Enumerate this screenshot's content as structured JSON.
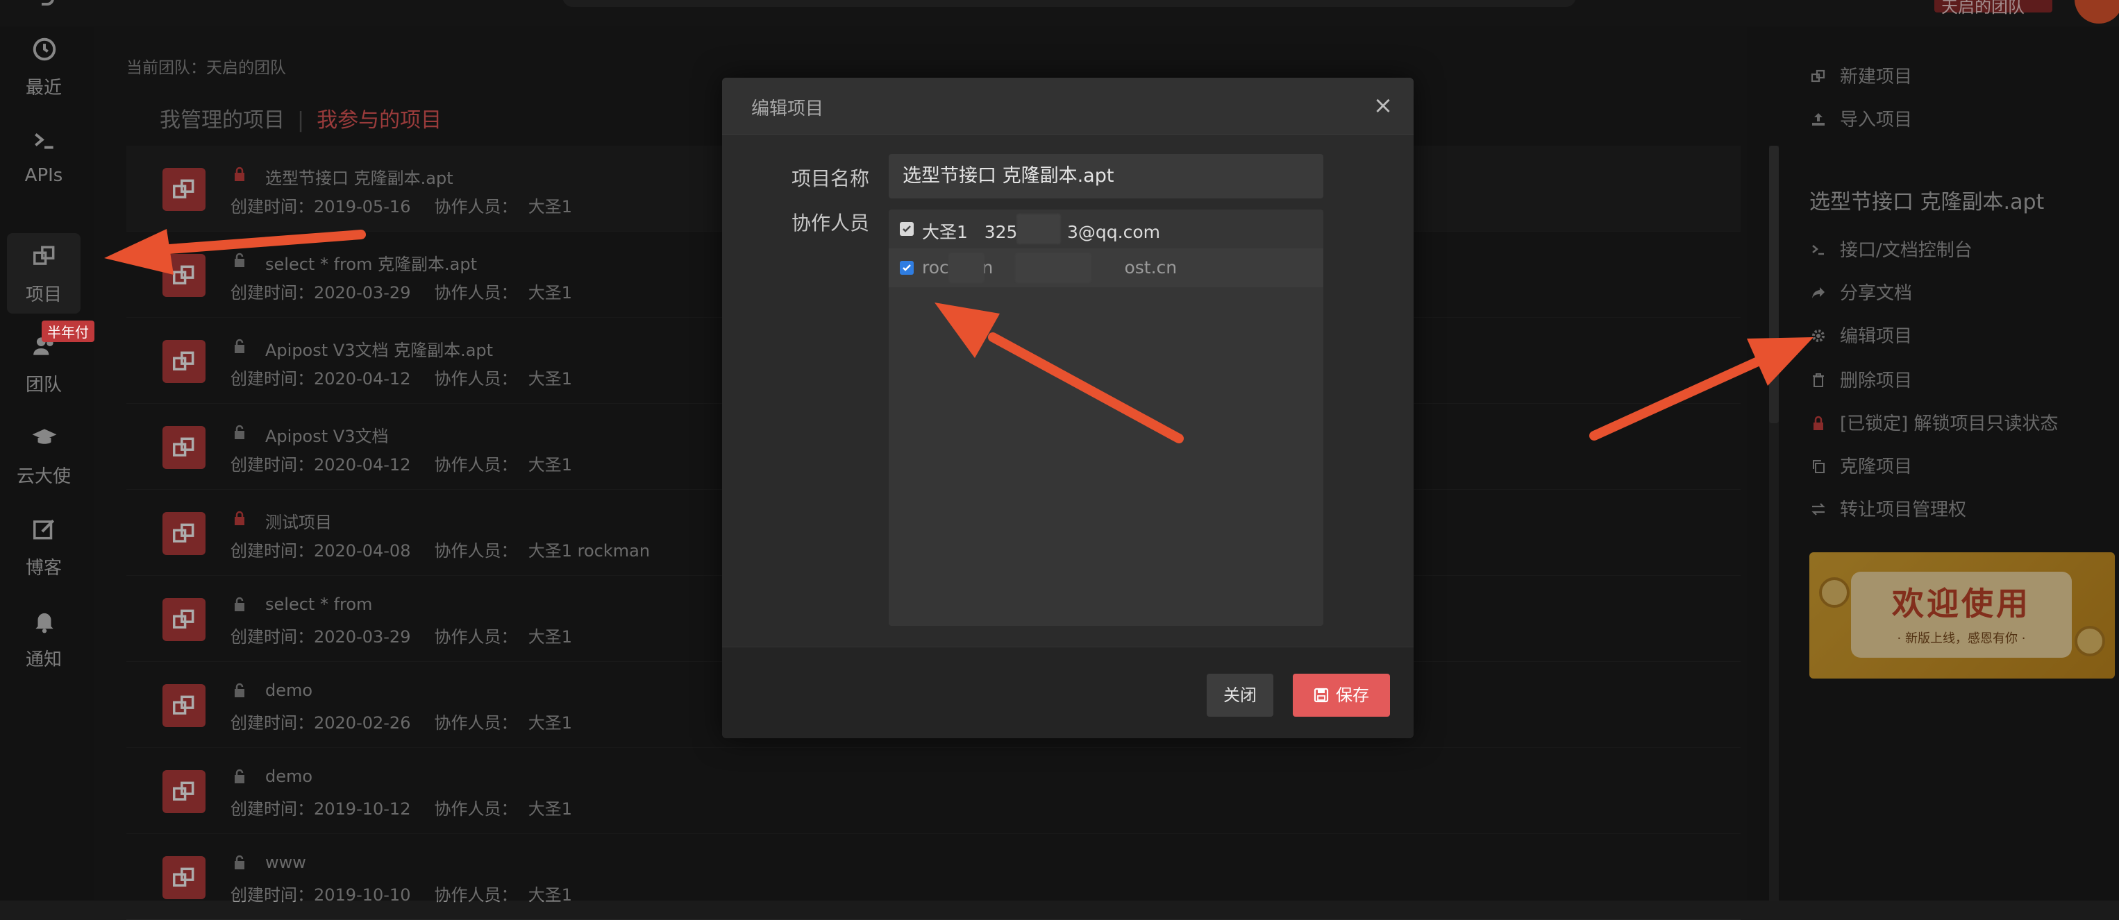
{
  "topbar": {
    "team_button": "天启的团队"
  },
  "nav": {
    "items": [
      {
        "label": "最近",
        "icon": "clock-icon"
      },
      {
        "label": "APIs",
        "icon": "terminal-icon"
      },
      {
        "label": "项目",
        "icon": "projects-icon"
      },
      {
        "label": "团队",
        "icon": "team-icon"
      },
      {
        "label": "云大使",
        "icon": "graduation-cap-icon"
      },
      {
        "label": "博客",
        "icon": "edit-icon"
      },
      {
        "label": "通知",
        "icon": "bell-icon"
      }
    ],
    "team_badge": "半年付"
  },
  "content": {
    "current_team": "当前团队：天启的团队",
    "tabs": {
      "manage": "我管理的项目",
      "join": "我参与的项目",
      "separator": "|"
    },
    "projects": [
      {
        "name": "选型节接口 克隆副本.apt",
        "created": "创建时间：2019-05-16",
        "collab": "协作人员：  大圣1",
        "locked": true
      },
      {
        "name": "select * from 克隆副本.apt",
        "created": "创建时间：2020-03-29",
        "collab": "协作人员：  大圣1",
        "locked": false
      },
      {
        "name": "Apipost V3文档 克隆副本.apt",
        "created": "创建时间：2020-04-12",
        "collab": "协作人员：  大圣1",
        "locked": false
      },
      {
        "name": "Apipost V3文档",
        "created": "创建时间：2020-04-12",
        "collab": "协作人员：  大圣1",
        "locked": false
      },
      {
        "name": "测试项目",
        "created": "创建时间：2020-04-08",
        "collab": "协作人员：  大圣1 rockman",
        "locked": true
      },
      {
        "name": "select * from",
        "created": "创建时间：2020-03-29",
        "collab": "协作人员：  大圣1",
        "locked": false
      },
      {
        "name": "demo",
        "created": "创建时间：2020-02-26",
        "collab": "协作人员：  大圣1",
        "locked": false
      },
      {
        "name": "demo",
        "created": "创建时间：2019-10-12",
        "collab": "协作人员：  大圣1",
        "locked": false
      },
      {
        "name": "www",
        "created": "创建时间：2019-10-10",
        "collab": "协作人员：  大圣1",
        "locked": false
      }
    ]
  },
  "right": {
    "new_project": "新建项目",
    "import_project": "导入项目",
    "selected_title": "选型节接口 克隆副本.apt",
    "actions": [
      {
        "label": "接口/文档控制台",
        "icon": "terminal-icon"
      },
      {
        "label": "分享文档",
        "icon": "share-icon"
      },
      {
        "label": "编辑项目",
        "icon": "gear-icon"
      },
      {
        "label": "删除项目",
        "icon": "trash-icon"
      },
      {
        "label": "[已锁定] 解锁项目只读状态",
        "icon": "lock-icon"
      },
      {
        "label": "克隆项目",
        "icon": "copy-icon"
      },
      {
        "label": "转让项目管理权",
        "icon": "transfer-icon"
      }
    ],
    "banner": {
      "title": "欢迎使用",
      "subtitle": "· 新版上线，感恩有你 ·"
    }
  },
  "modal": {
    "title": "编辑项目",
    "close_symbol": "×",
    "name_label": "项目名称",
    "name_value": "选型节接口 克隆副本.apt",
    "collab_label": "协作人员",
    "collaborators": [
      {
        "text": "大圣1   325         3@qq.com",
        "checked": true
      },
      {
        "text": "roc      n     tes              ost.cn",
        "checked": true
      }
    ],
    "close_button": "关闭",
    "save_button": "保存"
  },
  "colors": {
    "accent_red": "#e35a5a",
    "checkbox_blue": "#2f7de1",
    "arrow_orange": "#e8522f",
    "banner_gold": "#d9a533"
  }
}
